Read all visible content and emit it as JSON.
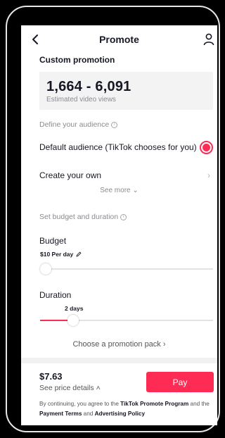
{
  "header": {
    "title": "Promote",
    "back_icon": "chevron-left-icon",
    "profile_icon": "person-icon"
  },
  "section": {
    "title": "Custom promotion"
  },
  "views": {
    "range": "1,664 - 6,091",
    "label": "Estimated video views"
  },
  "audience": {
    "heading": "Define your audience",
    "default_label": "Default audience (TikTok chooses for you)",
    "default_selected": true,
    "create_label": "Create your own",
    "see_more": "See more"
  },
  "budget_section": {
    "heading": "Set budget and duration"
  },
  "budget": {
    "label": "Budget",
    "value": "$10 Per day",
    "level": 0.0
  },
  "duration": {
    "label": "Duration",
    "value": "2 days",
    "level": 0.17
  },
  "promo_pack": {
    "label": "Choose a promotion pack"
  },
  "footer": {
    "price": "$7.63",
    "price_details": "See price details",
    "pay_label": "Pay",
    "terms_prefix": "By continuing, you agree to the ",
    "terms_link1": "TikTok Promote Program",
    "terms_mid1": " and the ",
    "terms_link2": "Payment Terms",
    "terms_mid2": " and ",
    "terms_link3": "Advertising Policy"
  },
  "colors": {
    "accent": "#fe2c55",
    "text": "#161823",
    "muted": "#8a8b91",
    "panel": "#f3f3f4"
  }
}
